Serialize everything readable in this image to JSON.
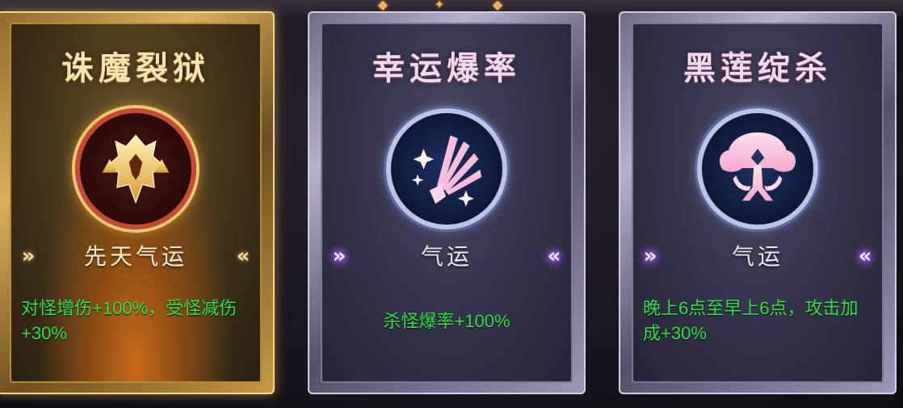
{
  "cards": [
    {
      "title": "诛魔裂狱",
      "subtitle": "先天气运",
      "description": "对怪增伤+100%，受怪减伤+30%",
      "style": "gold",
      "icon": "demon-lion-emblem-icon"
    },
    {
      "title": "幸运爆率",
      "subtitle": "气运",
      "description": "杀怪爆率+100%",
      "style": "purple",
      "icon": "fan-sparkle-emblem-icon"
    },
    {
      "title": "黑莲绽杀",
      "subtitle": "气运",
      "description": "晚上6点至早上6点，攻击加成+30%",
      "style": "purple",
      "icon": "tree-lotus-emblem-icon"
    }
  ],
  "colors": {
    "description_text": "#35e04a",
    "gold_frame": "#d9b15c",
    "purple_frame": "#b6b2cc"
  },
  "chevron_left": "»",
  "chevron_right": "«"
}
